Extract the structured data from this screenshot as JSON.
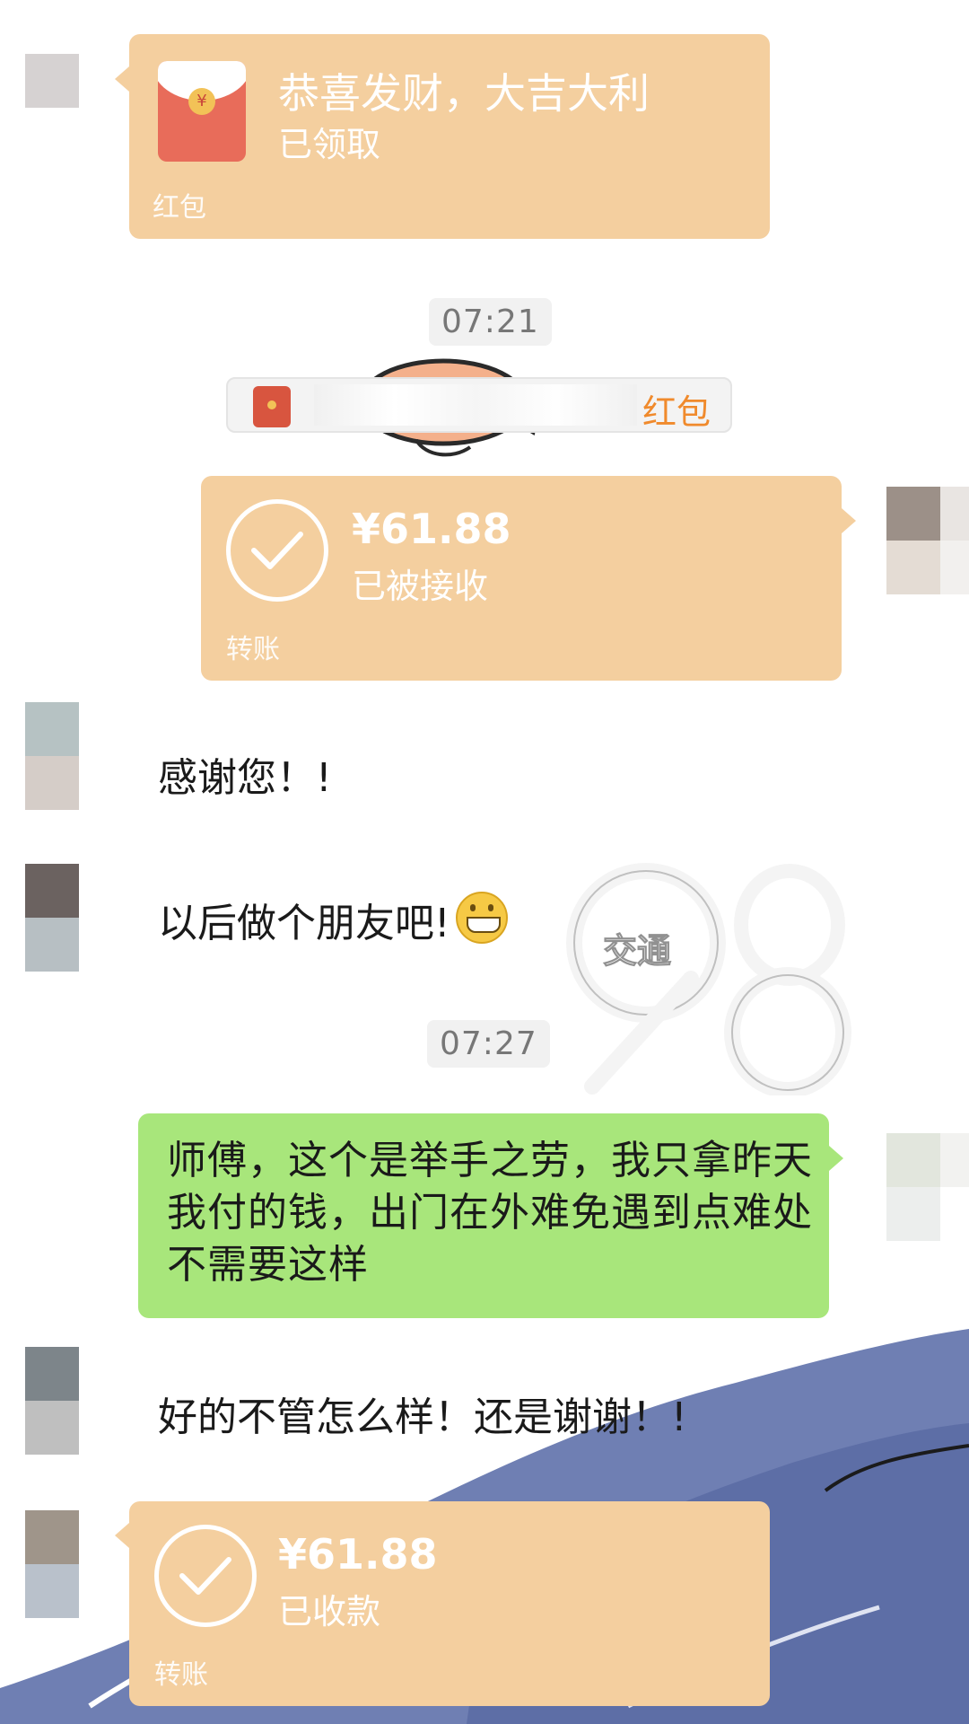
{
  "messages": {
    "red_packet": {
      "title": "恭喜发财，大吉大利",
      "status": "已领取",
      "label": "红包",
      "icon": "red-envelope-icon"
    },
    "time_1": "07:21",
    "notice": {
      "label": "红包",
      "icon": "red-envelope-icon"
    },
    "transfer_sent": {
      "amount": "¥61.88",
      "status": "已被接收",
      "label": "转账",
      "icon": "check-circle-icon"
    },
    "text_1": "感谢您！!",
    "text_2": "以后做个朋友吧!",
    "text_2_emoji": "grinning-face-emoji",
    "time_2": "07:27",
    "text_3": "师傅，这个是举手之劳，我只拿昨天我付的钱，出门在外难免遇到点难处不需要这样",
    "text_4": "好的不管怎么样！还是谢谢！!",
    "transfer_received": {
      "amount": "¥61.88",
      "status": "已收款",
      "label": "转账",
      "icon": "check-circle-icon"
    }
  },
  "watermark": {
    "text": "交通",
    "logo": "98"
  },
  "colors": {
    "transfer_bg": "#f4cf9f",
    "my_bubble": "#a8e67b",
    "time_bg": "#f1f1f1",
    "notice_accent": "#f08a2c"
  }
}
